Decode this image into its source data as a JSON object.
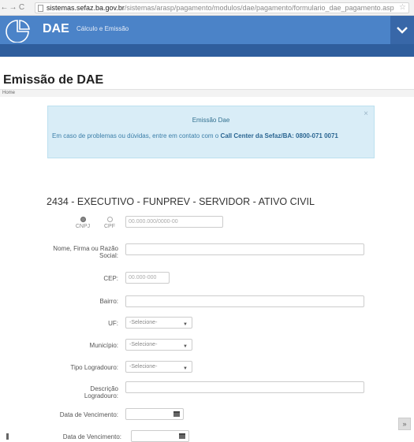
{
  "browser": {
    "back": "←",
    "forward": "→",
    "reload": "C",
    "url_host": "sistemas.sefaz.ba.gov.br",
    "url_path": "/sistemas/arasp/pagamento/modulos/dae/pagamento/formulario_dae_pagamento.asp",
    "star": "☆"
  },
  "header": {
    "brand": "DAE",
    "subtitle": "Cálculo e Emissão"
  },
  "page": {
    "title": "Emissão de DAE",
    "breadcrumb": "Home"
  },
  "alert": {
    "close": "×",
    "title": "Emissão Dae",
    "text": "Em caso de problemas ou dúvidas, entre em contato com o",
    "link_text": "Call Center da Sefaz/BA: 0800-071 0071"
  },
  "form": {
    "section_title": "2434 - EXECUTIVO - FUNPREV - SERVIDOR - ATIVO CIVIL",
    "doc_type": {
      "options": [
        "CNPJ",
        "CPF"
      ],
      "selected": "CNPJ"
    },
    "document_placeholder": "00.000.000/0000-00",
    "name_label": "Nome, Firma ou Razão Social:",
    "cep_label": "CEP:",
    "cep_placeholder": "00.000-000",
    "bairro_label": "Bairro:",
    "uf_label": "UF:",
    "uf_value": "-Selecione-",
    "municipio_label": "Município:",
    "municipio_value": "-Selecione-",
    "tipo_logradouro_label": "Tipo Logradouro:",
    "tipo_logradouro_value": "-Selecione-",
    "descricao_label": "Descrição Logradouro:",
    "vencimento_label": "Data de Vencimento:",
    "vencimento2_label": "Data de Vencimento:"
  },
  "scroll_top": "»"
}
